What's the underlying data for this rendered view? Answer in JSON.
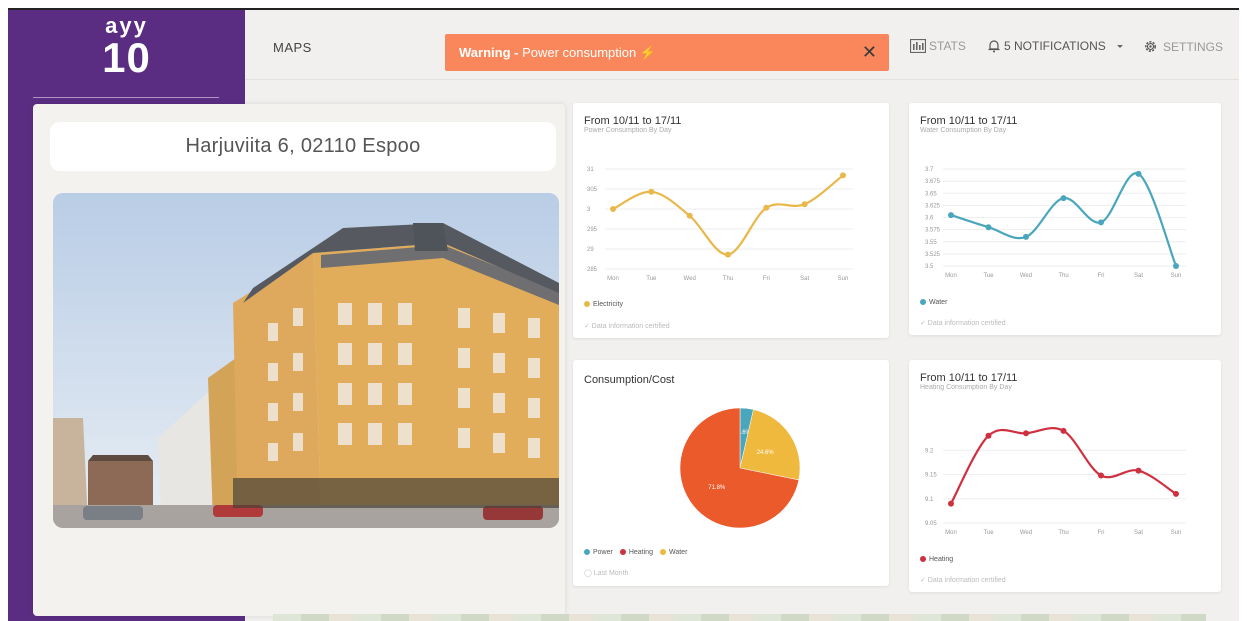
{
  "logo": {
    "line1": "ayy",
    "line2": "10"
  },
  "topbar": {
    "maps": "MAPS",
    "warning_bold": "Warning -",
    "warning_text": "Power consumption ⚡",
    "close": "✕",
    "stats": "STATS",
    "notifications": "5 NOTIFICATIONS",
    "settings": "SETTINGS",
    "icons": [
      "stats-icon",
      "bell-icon",
      "chevron-down-icon",
      "gear-icon",
      "close-icon"
    ]
  },
  "address": "Harjuviita 6, 02110 Espoo",
  "colors": {
    "sidebar": "#5a2d82",
    "warning": "#f9875b",
    "power": "#e8b84b",
    "water": "#4aa6bd",
    "heating": "#cf3040",
    "pie_heating": "#eb5a2a",
    "pie_water": "#efb93e",
    "pie_power": "#4aa6bd"
  },
  "cards": {
    "power": {
      "title": "From 10/11 to 17/11",
      "sub": "Power Consumption By Day",
      "legend": "Electricity",
      "foot": "✓ Data information certified"
    },
    "water": {
      "title": "From 10/11 to 17/11",
      "sub": "Water Consumption By Day",
      "legend": "Water",
      "foot": "✓ Data information certified"
    },
    "pie": {
      "title": "Consumption/Cost",
      "legend": [
        "Power",
        "Heating",
        "Water"
      ],
      "foot": "Last Month"
    },
    "heating": {
      "title": "From 10/11 to 17/11",
      "sub": "Heating Consumption By Day",
      "legend": "Heating",
      "foot": "✓ Data information certified"
    }
  },
  "chart_data": [
    {
      "type": "line",
      "x": [
        "Mon",
        "Tue",
        "Wed",
        "Thu",
        "Fri",
        "Sat",
        "Sun"
      ],
      "series": [
        {
          "name": "Electricity",
          "values": [
            3000,
            3043,
            2983,
            2886,
            3003,
            3012,
            3084
          ]
        }
      ],
      "ylim": [
        2850,
        3100
      ],
      "yticks": [
        2850,
        2900,
        2950,
        3000,
        3050,
        3100
      ],
      "grid": true
    },
    {
      "type": "line",
      "x": [
        "Mon",
        "Tue",
        "Wed",
        "Thu",
        "Fri",
        "Sat",
        "Sun"
      ],
      "series": [
        {
          "name": "Water",
          "values": [
            3.605,
            3.58,
            3.56,
            3.64,
            3.59,
            3.69,
            3.5
          ]
        }
      ],
      "ylim": [
        3.5,
        3.7
      ],
      "yticks": [
        3.5,
        3.525,
        3.55,
        3.575,
        3.6,
        3.625,
        3.65,
        3.675,
        3.7
      ],
      "grid": true
    },
    {
      "type": "pie",
      "categories": [
        "Power",
        "Heating",
        "Water"
      ],
      "values": [
        3.6,
        71.8,
        24.6
      ],
      "labels": [
        "3.6%",
        "71.8%",
        "24.6%"
      ]
    },
    {
      "type": "line",
      "x": [
        "Mon",
        "Tue",
        "Wed",
        "Thu",
        "Fri",
        "Sat",
        "Sun"
      ],
      "series": [
        {
          "name": "Heating",
          "values": [
            9.09,
            9.23,
            9.235,
            9.24,
            9.148,
            9.158,
            9.11
          ]
        }
      ],
      "ylim": [
        9.05,
        9.25
      ],
      "yticks": [
        9.05,
        9.1,
        9.15,
        9.2
      ],
      "grid": true
    }
  ]
}
